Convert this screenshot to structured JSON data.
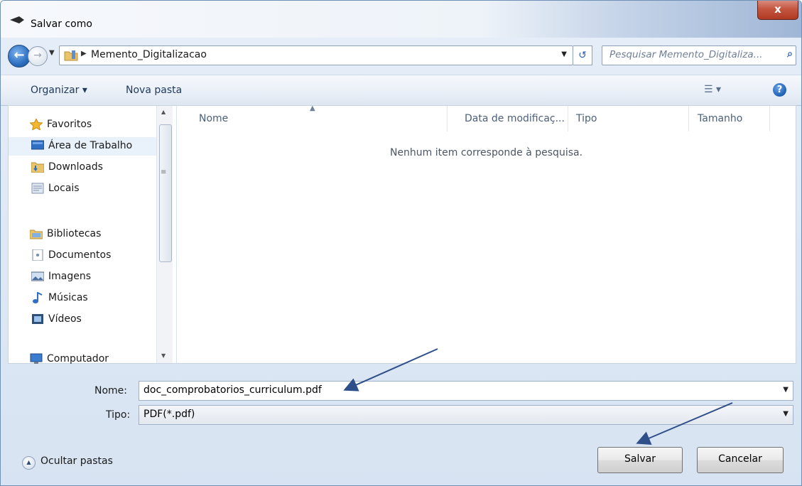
{
  "window": {
    "title": "Salvar como",
    "close_label": "x"
  },
  "address": {
    "path": "Memento_Digitalizacao",
    "search_placeholder": "Pesquisar Memento_Digitaliza..."
  },
  "toolbar": {
    "organize_label": "Organizar ▾",
    "new_folder_label": "Nova pasta"
  },
  "nav": {
    "items": [
      {
        "label": "Favoritos",
        "icon": "star-icon"
      },
      {
        "label": "Área de Trabalho",
        "icon": "desktop-icon",
        "selected": true
      },
      {
        "label": "Downloads",
        "icon": "downloads-folder-icon"
      },
      {
        "label": "Locais",
        "icon": "places-icon"
      },
      {
        "label": "Bibliotecas",
        "icon": "libraries-icon"
      },
      {
        "label": "Documentos",
        "icon": "documents-icon"
      },
      {
        "label": "Imagens",
        "icon": "images-icon"
      },
      {
        "label": "Músicas",
        "icon": "music-icon"
      },
      {
        "label": "Vídeos",
        "icon": "videos-icon"
      },
      {
        "label": "Computador",
        "icon": "computer-icon"
      }
    ]
  },
  "file_list": {
    "columns": [
      "Nome",
      "Data de modificaç...",
      "Tipo",
      "Tamanho"
    ],
    "empty_message": "Nenhum item corresponde à pesquisa."
  },
  "form": {
    "name_label": "Nome:",
    "name_value": "doc_comprobatorios_curriculum.pdf",
    "type_label": "Tipo:",
    "type_value": "PDF(*.pdf)"
  },
  "footer": {
    "hide_folders_label": "Ocultar pastas",
    "save_label": "Salvar",
    "cancel_label": "Cancelar"
  },
  "colors": {
    "annotation_arrow": "#2f4f8a",
    "close_button": "#c4553f"
  }
}
